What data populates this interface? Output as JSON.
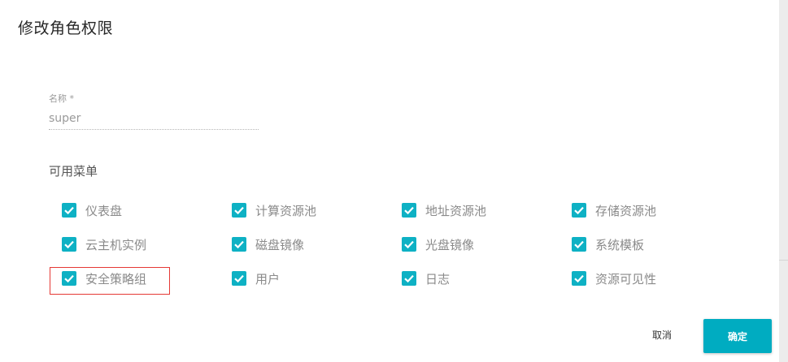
{
  "dialog": {
    "title": "修改角色权限",
    "name_field": {
      "label": "名称 *",
      "value": "super"
    },
    "menus_label": "可用菜单",
    "menus": [
      {
        "label": "仪表盘",
        "checked": true
      },
      {
        "label": "计算资源池",
        "checked": true
      },
      {
        "label": "地址资源池",
        "checked": true
      },
      {
        "label": "存储资源池",
        "checked": true
      },
      {
        "label": "云主机实例",
        "checked": true
      },
      {
        "label": "磁盘镜像",
        "checked": true
      },
      {
        "label": "光盘镜像",
        "checked": true
      },
      {
        "label": "系统模板",
        "checked": true
      },
      {
        "label": "安全策略组",
        "checked": true
      },
      {
        "label": "用户",
        "checked": true
      },
      {
        "label": "日志",
        "checked": true
      },
      {
        "label": "资源可见性",
        "checked": true
      }
    ],
    "cancel_label": "取消",
    "ok_label": "确定"
  },
  "colors": {
    "accent": "#00acc1",
    "checkbox": "#0eb1c4",
    "highlight": "#e53935"
  }
}
